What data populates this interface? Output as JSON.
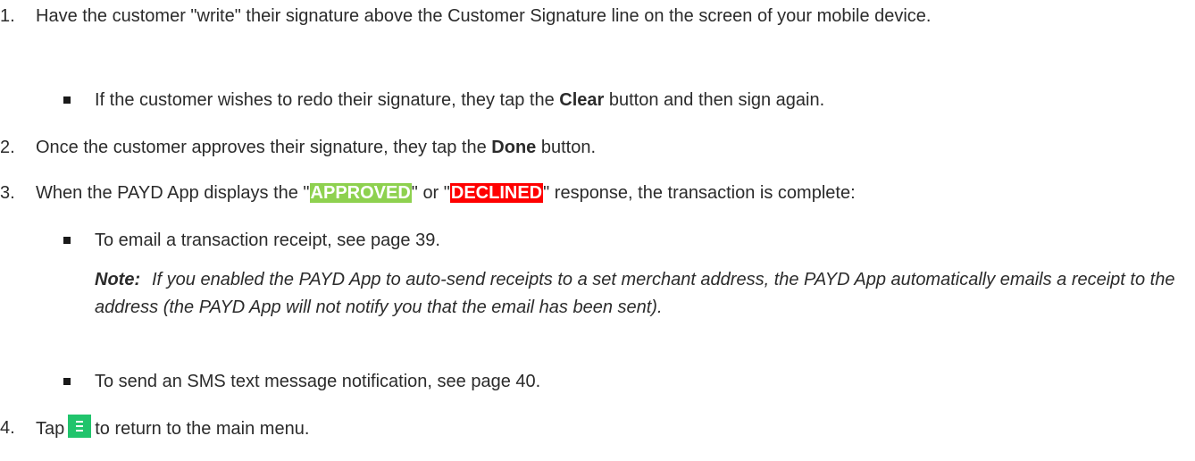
{
  "steps": [
    {
      "number": "1.",
      "text": "Have the customer \"write\" their signature above the Customer Signature line on the screen of your mobile device.",
      "bullet": {
        "before": "If the customer wishes to redo their signature, they tap the ",
        "bold": "Clear",
        "after": " button and then sign again."
      }
    },
    {
      "number": "2.",
      "before": "Once the customer approves their signature, they tap the ",
      "bold": "Done",
      "after": " button."
    },
    {
      "number": "3.",
      "before": "When the PAYD App displays the \"",
      "approved": "APPROVED",
      "middle": "\" or \"",
      "declined": "DECLINED",
      "after": "\" response, the transaction is complete:",
      "bullets": [
        "To email a transaction receipt, see page 39.",
        "To send an SMS text message notification, see page 40."
      ],
      "note": {
        "label": "Note:",
        "text": "If you enabled the PAYD App to auto-send receipts to a set merchant address, the PAYD App automatically emails a receipt to the address (the PAYD App will not notify you that the email has been sent)."
      }
    },
    {
      "number": "4.",
      "before": "Tap",
      "after": "to return to the main menu.",
      "icon": "menu-icon"
    }
  ],
  "colors": {
    "approved": "#8ed14f",
    "declined": "#ff0000",
    "menu_icon": "#21c46c"
  }
}
